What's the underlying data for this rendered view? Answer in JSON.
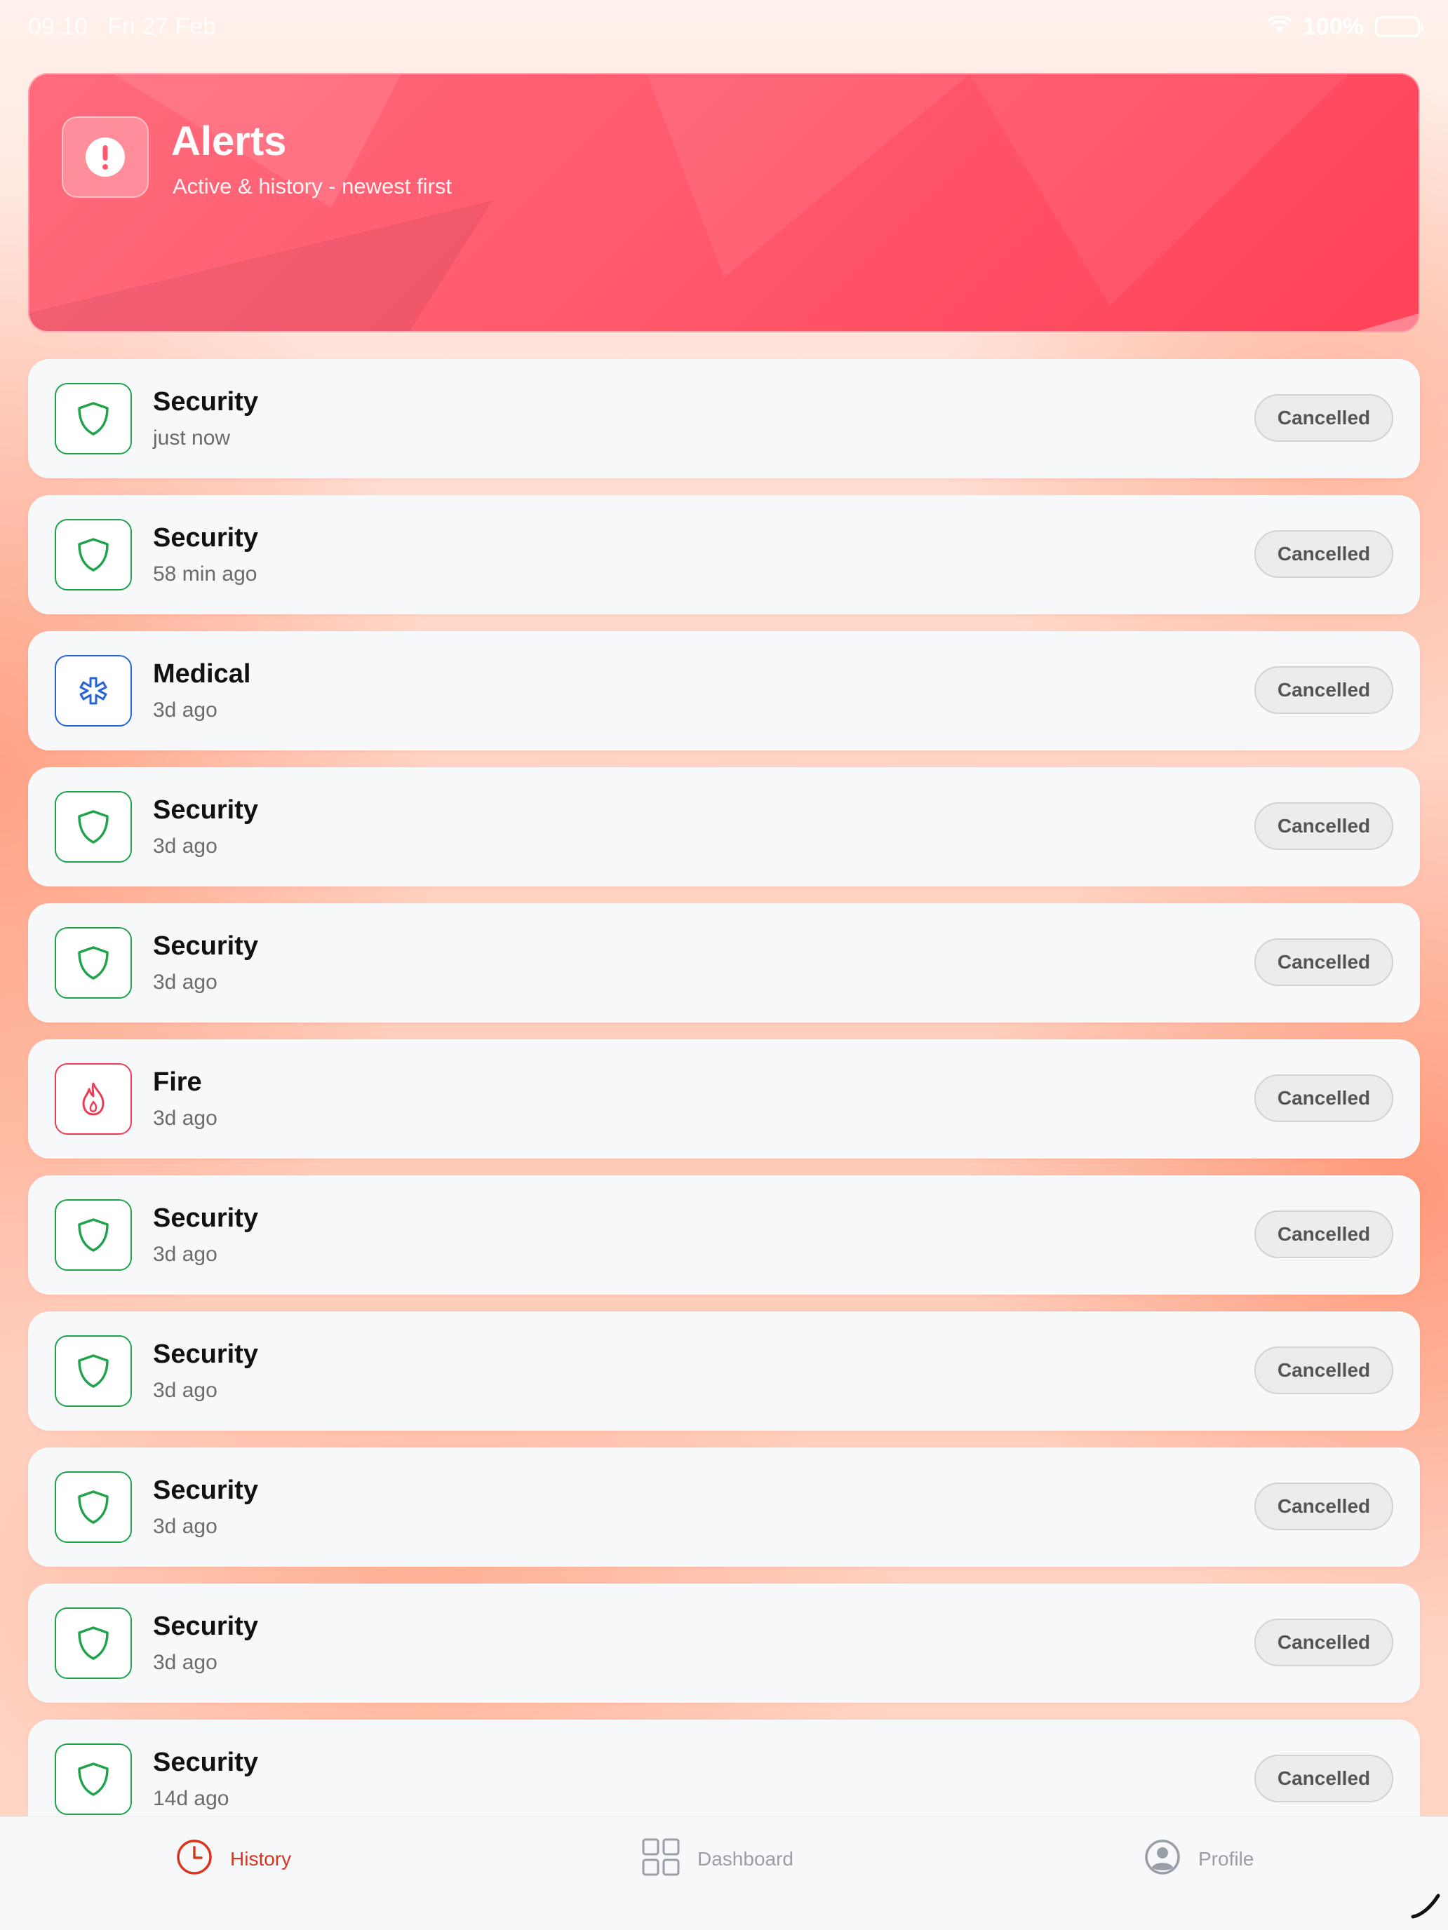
{
  "status_bar": {
    "time": "09:10",
    "date": "Fri 27 Feb",
    "battery": "100%"
  },
  "header": {
    "title": "Alerts",
    "subtitle": "Active & history - newest first",
    "icon": "alert-circle-icon"
  },
  "alerts": [
    {
      "type": "Security",
      "time": "just now",
      "status": "Cancelled",
      "icon": "shield-icon"
    },
    {
      "type": "Security",
      "time": "58 min ago",
      "status": "Cancelled",
      "icon": "shield-icon"
    },
    {
      "type": "Medical",
      "time": "3d ago",
      "status": "Cancelled",
      "icon": "medical-asterisk-icon"
    },
    {
      "type": "Security",
      "time": "3d ago",
      "status": "Cancelled",
      "icon": "shield-icon"
    },
    {
      "type": "Security",
      "time": "3d ago",
      "status": "Cancelled",
      "icon": "shield-icon"
    },
    {
      "type": "Fire",
      "time": "3d ago",
      "status": "Cancelled",
      "icon": "flame-icon"
    },
    {
      "type": "Security",
      "time": "3d ago",
      "status": "Cancelled",
      "icon": "shield-icon"
    },
    {
      "type": "Security",
      "time": "3d ago",
      "status": "Cancelled",
      "icon": "shield-icon"
    },
    {
      "type": "Security",
      "time": "3d ago",
      "status": "Cancelled",
      "icon": "shield-icon"
    },
    {
      "type": "Security",
      "time": "3d ago",
      "status": "Cancelled",
      "icon": "shield-icon"
    },
    {
      "type": "Security",
      "time": "14d ago",
      "status": "Cancelled",
      "icon": "shield-icon"
    }
  ],
  "nav": {
    "history": "History",
    "dashboard": "Dashboard",
    "profile": "Profile",
    "active": "history"
  },
  "colors": {
    "accent": "#ff5a6e",
    "security": "#1fa34a",
    "medical": "#2563d6",
    "fire": "#ee3b55",
    "nav_active": "#d9361f"
  }
}
